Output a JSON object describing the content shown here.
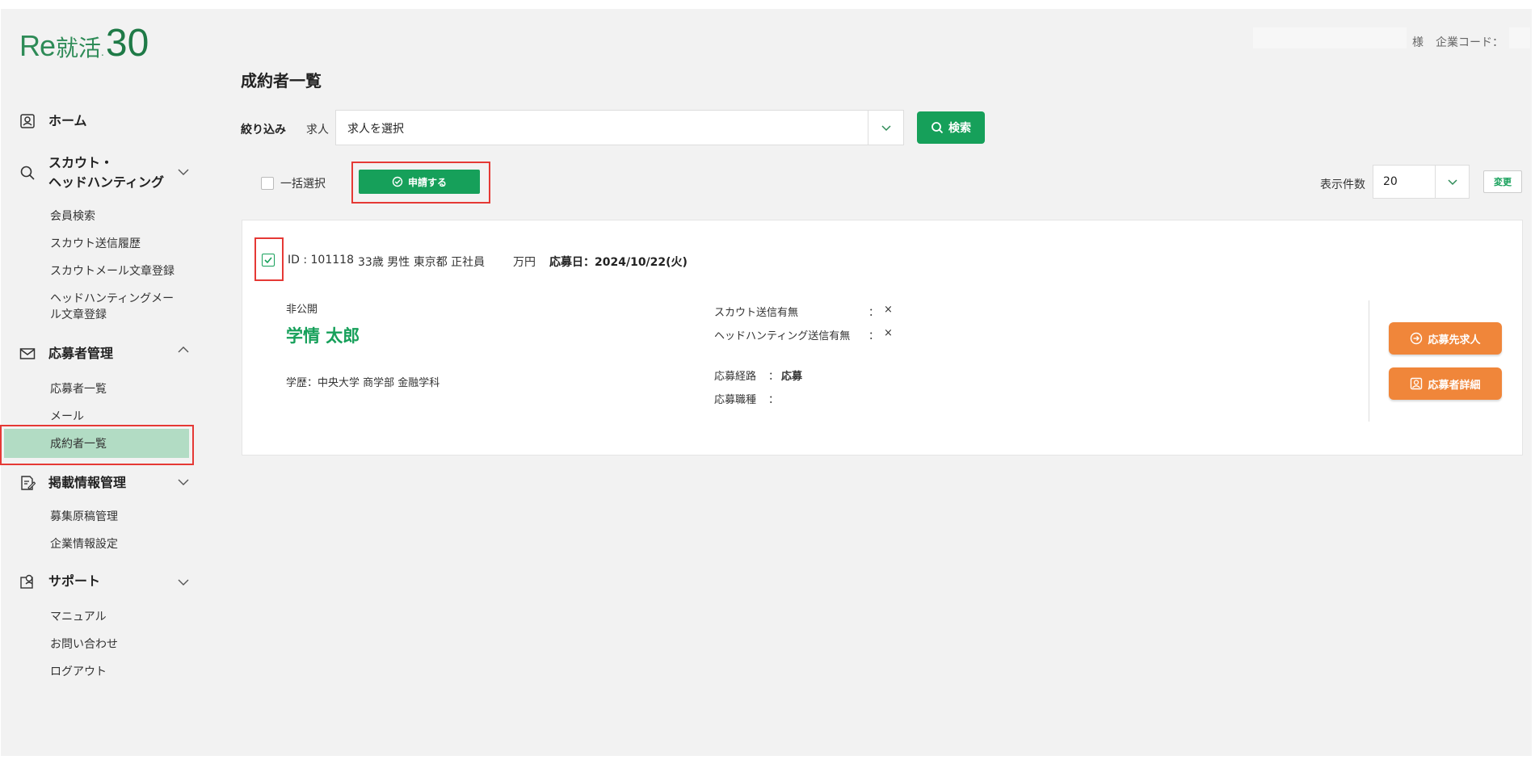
{
  "brand": {
    "logo_re": "Re",
    "logo_kanji": "就活",
    "logo_dot": ".",
    "logo_num": "30"
  },
  "header": {
    "sama": "様",
    "company_code_label": "企業コード："
  },
  "sidebar": {
    "home": "ホーム",
    "scout_line1": "スカウト・",
    "scout_line2": "ヘッドハンティング",
    "scout_items": [
      "会員検索",
      "スカウト送信履歴",
      "スカウトメール文章登録",
      "ヘッドハンティングメー",
      "ル文章登録"
    ],
    "applicants": "応募者管理",
    "applicant_items": [
      "応募者一覧",
      "メール",
      "成約者一覧"
    ],
    "listing": "掲載情報管理",
    "listing_items": [
      "募集原稿管理",
      "企業情報設定"
    ],
    "support": "サポート",
    "support_items": [
      "マニュアル",
      "お問い合わせ",
      "ログアウト"
    ]
  },
  "main": {
    "title": "成約者一覧",
    "filter_label": "絞り込み",
    "filter_sub": "求人",
    "job_select_value": "求人を選択",
    "search_button": "検索",
    "bulk_select_label": "一括選択",
    "apply_button": "申請する",
    "display_count_label": "表示件数",
    "display_count_value": "20",
    "change_button": "変更"
  },
  "card": {
    "id": "ID : 101118",
    "profile": "33歳 男性 東京都 正社員",
    "salary": "万円",
    "apply_date": "応募日：2024/10/22(火)",
    "visibility": "非公開",
    "name": "学情 太郎",
    "education": "学歴：中央大学 商学部 金融学科",
    "scout_sent_label": "スカウト送信有無",
    "scout_sent_value": "×",
    "headhunt_sent_label": "ヘッドハンティング送信有無",
    "headhunt_sent_value": "×",
    "route_label": "応募経路",
    "route_value": "応募",
    "job_type_label": "応募職種",
    "colon": "：",
    "btn_job": "応募先求人",
    "btn_detail": "応募者詳細"
  },
  "colors": {
    "green": "#16a05a",
    "orange": "#f0863a",
    "active_bg": "#b2dcc4",
    "highlight": "#e53935"
  }
}
